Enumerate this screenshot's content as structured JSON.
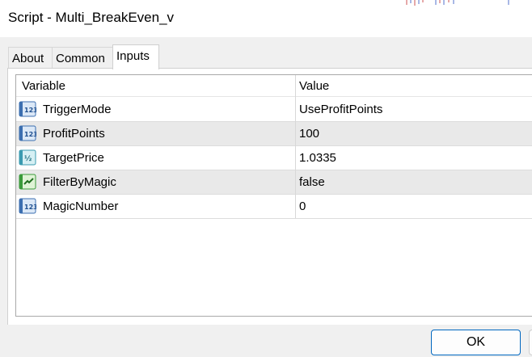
{
  "window": {
    "title": "Script - Multi_BreakEven_v"
  },
  "tabs": [
    {
      "label": "About",
      "active": false
    },
    {
      "label": "Common",
      "active": false
    },
    {
      "label": "Inputs",
      "active": true
    }
  ],
  "grid": {
    "columns": [
      "Variable",
      "Value"
    ],
    "rows": [
      {
        "icon": "integer-123-icon",
        "name": "TriggerMode",
        "value": "UseProfitPoints"
      },
      {
        "icon": "integer-123-icon",
        "name": "ProfitPoints",
        "value": "100"
      },
      {
        "icon": "fraction-half-icon",
        "name": "TargetPrice",
        "value": "1.0335"
      },
      {
        "icon": "boolean-toggle-icon",
        "name": "FilterByMagic",
        "value": "false"
      },
      {
        "icon": "integer-123-icon",
        "name": "MagicNumber",
        "value": "0"
      }
    ]
  },
  "footer": {
    "ok_label": "OK"
  },
  "colors": {
    "accent_border": "#0067c0",
    "alt_row": "#e9e9e9",
    "window_bg": "#f0f0f0"
  }
}
